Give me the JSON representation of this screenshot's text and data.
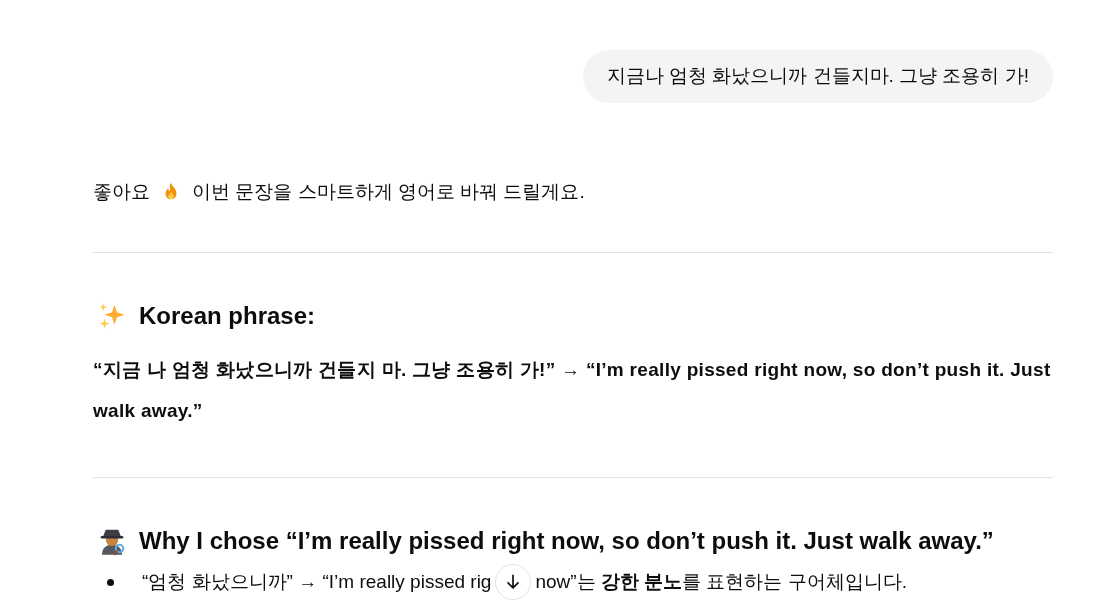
{
  "user_message": {
    "text": "지금나 엄청 화났으니까 건들지마. 그냥 조용히 가!"
  },
  "assistant": {
    "intro": {
      "before": "좋아요",
      "after": "이번 문장을 스마트하게 영어로 바꿔 드릴게요."
    },
    "sections": [
      {
        "heading": "Korean phrase:",
        "paragraph": "“지금 나 엄청 화났으니까 건들지 마. 그냥 조용히 가!” → “I’m really pissed right now, so don’t push it. Just walk away.”"
      },
      {
        "heading": "Why I chose “I’m really pissed right now, so don’t push it. Just walk away.”",
        "bullets": [
          {
            "before": "“엄청 화났으니까” → “I’m really pissed rig",
            "after": "now”는 **강한 분노**를 표현하는 구어체입니다."
          }
        ]
      }
    ]
  }
}
